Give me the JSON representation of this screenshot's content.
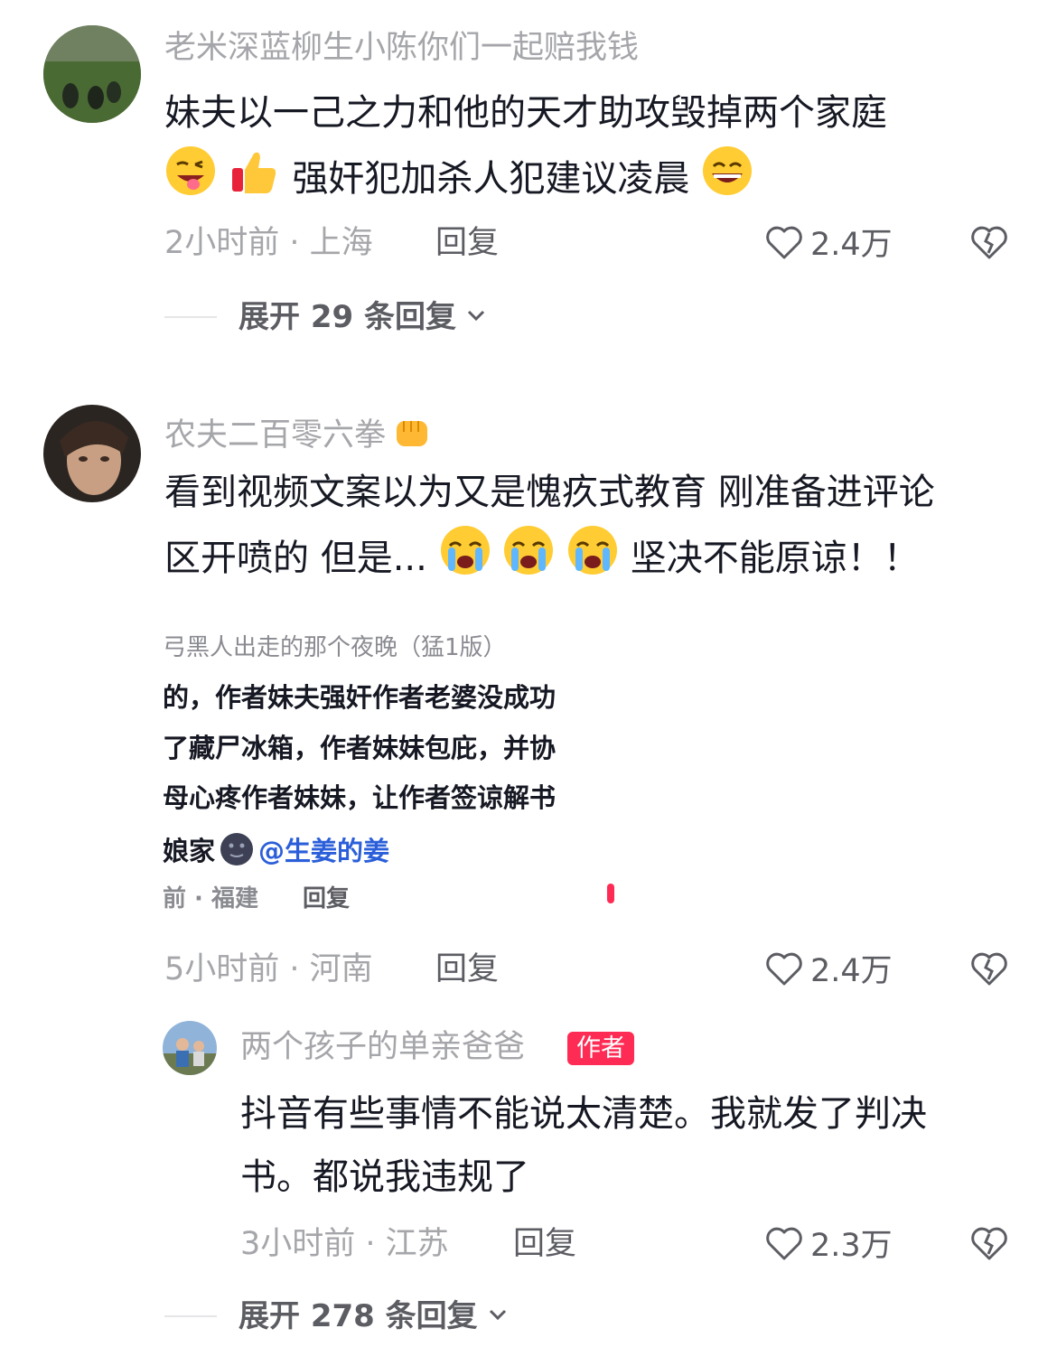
{
  "comments": [
    {
      "username": "老米深蓝柳生小陈你们一起赔我钱",
      "text_line1": "妹夫以一己之力和他的天才助攻毁掉两个家庭",
      "text_line2_after_emoji": "强奸犯加杀人犯建议凌晨",
      "emoji_icons": [
        "winking-tongue-emoji",
        "thumbs-up-emoji",
        "grinning-sweat-emoji"
      ],
      "time_location": "2小时前 · 上海",
      "reply_label": "回复",
      "like_count": "2.4万",
      "expand_label": "展开 29 条回复"
    },
    {
      "username": "农夫二百零六拳",
      "username_emoji": "fist-emoji",
      "text_line1": "看到视频文案以为又是愧疚式教育 刚准备进评论",
      "text_line2": "区开喷的 但是...",
      "text_line2_tail": "坚决不能原谅！！",
      "emoji_icons": [
        "crying-face-emoji",
        "crying-face-emoji",
        "crying-face-emoji"
      ],
      "embedded_screenshot": {
        "title": "弓黑人出走的那个夜晚（猛1版）",
        "line1": "的，作者妹夫强奸作者老婆没成功",
        "line2": "了藏尸冰箱，作者妹妹包庇，并协",
        "line3": "母心疼作者妹妹，让作者签谅解书",
        "line4_prefix": "娘家",
        "mention": "@生姜的姜",
        "meta": "前 · 福建",
        "reply": "回复"
      },
      "time_location": "5小时前 · 河南",
      "reply_label": "回复",
      "like_count": "2.4万"
    }
  ],
  "author_reply": {
    "username": "两个孩子的单亲爸爸",
    "badge": "作者",
    "text_line1": "抖音有些事情不能说太清楚。我就发了判决",
    "text_line2": "书。都说我违规了",
    "time_location": "3小时前 · 江苏",
    "reply_label": "回复",
    "like_count": "2.3万",
    "expand_label": "展开 278 条回复"
  },
  "icons": {
    "like": "heart-outline-icon",
    "dislike": "broken-heart-icon",
    "expand": "chevron-down-icon"
  }
}
